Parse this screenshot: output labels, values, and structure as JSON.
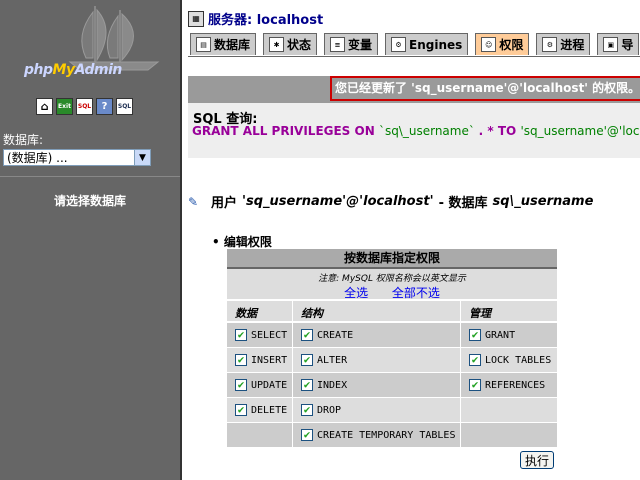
{
  "left": {
    "logo": {
      "php": "php",
      "my": "My",
      "admin": "Admin"
    },
    "icons": [
      {
        "name": "home-icon",
        "glyph": "⌂"
      },
      {
        "name": "exit-icon",
        "glyph": "Exit"
      },
      {
        "name": "sql-icon",
        "glyph": "SQL"
      },
      {
        "name": "help-icon",
        "glyph": "?"
      },
      {
        "name": "docs-icon",
        "glyph": "SQL"
      }
    ],
    "db_label": "数据库:",
    "db_select_value": "(数据库) ...",
    "choose_db": "请选择数据库"
  },
  "right": {
    "server": "服务器: localhost",
    "tabs": [
      {
        "label": "数据库",
        "icon": "database-icon",
        "active": false
      },
      {
        "label": "状态",
        "icon": "status-icon",
        "active": false
      },
      {
        "label": "变量",
        "icon": "variables-icon",
        "active": false
      },
      {
        "label": "Engines",
        "icon": "engines-icon",
        "active": false
      },
      {
        "label": "权限",
        "icon": "privileges-icon",
        "active": true
      },
      {
        "label": "进程",
        "icon": "processes-icon",
        "active": false
      },
      {
        "label": "导",
        "icon": "export-icon",
        "active": false
      }
    ],
    "message": "您已经更新了 'sq_username'@'localhost' 的权限。",
    "sql": {
      "label": "SQL 查询:",
      "keyword1": "GRANT ALL PRIVILEGES ON ",
      "lit1": "`sq\\_username` ",
      "keyword2": ". * TO ",
      "lit2": "'sq_username'@'localhost'"
    },
    "user_line": {
      "prefix": "用户",
      "user": "'sq_username'@'localhost'",
      "middle": "- 数据库",
      "db": "sq\\_username"
    },
    "edit_label": "编辑权限"
  },
  "privileges": {
    "title": "按数据库指定权限",
    "note": "注意: MySQL 权限名称会以英文显示",
    "select_all": "全选",
    "deselect_all": "全部不选",
    "col_data": "数据",
    "col_structure": "结构",
    "col_admin": "管理",
    "rows": [
      {
        "data": "SELECT",
        "structure": "CREATE",
        "admin": "GRANT"
      },
      {
        "data": "INSERT",
        "structure": "ALTER",
        "admin": "LOCK TABLES"
      },
      {
        "data": "UPDATE",
        "structure": "INDEX",
        "admin": "REFERENCES"
      },
      {
        "data": "DELETE",
        "structure": "DROP",
        "admin": ""
      },
      {
        "data": "",
        "structure": "CREATE TEMPORARY TABLES",
        "admin": ""
      }
    ],
    "go": "执行"
  }
}
